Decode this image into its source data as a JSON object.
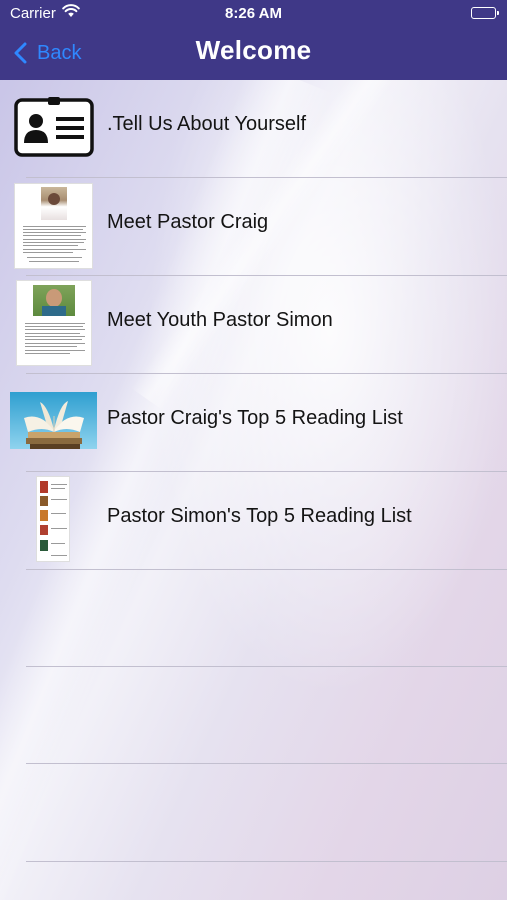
{
  "status_bar": {
    "carrier": "Carrier",
    "time": "8:26 AM",
    "icons": [
      "wifi-icon",
      "battery-icon"
    ]
  },
  "nav": {
    "back_label": "Back",
    "title": "Welcome",
    "bar_color": "#3f3887",
    "back_color": "#2f88ff"
  },
  "menu": {
    "items": [
      {
        "label": ".Tell Us About Yourself",
        "thumb": "contact-card-icon"
      },
      {
        "label": "Meet Pastor Craig",
        "thumb": "pastor-craig-thumbnail"
      },
      {
        "label": "Meet Youth Pastor Simon",
        "thumb": "pastor-simon-thumbnail"
      },
      {
        "label": "Pastor Craig's Top 5 Reading List",
        "thumb": "open-book-thumbnail"
      },
      {
        "label": "Pastor Simon's Top 5 Reading List",
        "thumb": "book-list-thumbnail"
      }
    ]
  }
}
